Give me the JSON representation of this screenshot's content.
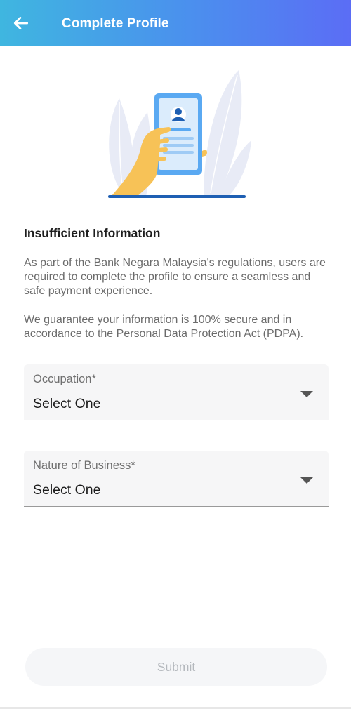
{
  "header": {
    "title": "Complete Profile",
    "back_icon": "arrow-left-icon"
  },
  "illustration": {
    "name": "phone-profile-illustration",
    "colors": {
      "leaf": "#e7eaf6",
      "hand": "#f7c257",
      "phone": "#5aa9f2",
      "screen": "#dbecfc",
      "ground": "#1e5fb3"
    }
  },
  "info": {
    "title": "Insufficient Information",
    "paragraph1": "As part of the Bank Negara Malaysia's regulations, users are required to complete the profile to ensure a seamless and safe payment experience.",
    "paragraph2": "We guarantee your information is 100% secure and in accordance to the Personal Data Protection Act (PDPA)."
  },
  "form": {
    "occupation": {
      "label": "Occupation*",
      "value": "Select One"
    },
    "nature_of_business": {
      "label": "Nature of Business*",
      "value": "Select One"
    }
  },
  "submit": {
    "label": "Submit",
    "enabled": false
  },
  "colors": {
    "header_gradient_start": "#3fb6e0",
    "header_gradient_end": "#5b6df5",
    "text_primary": "#1e1e1e",
    "text_secondary": "#6b6b6b",
    "submit_disabled_text": "#b4b8bd"
  }
}
